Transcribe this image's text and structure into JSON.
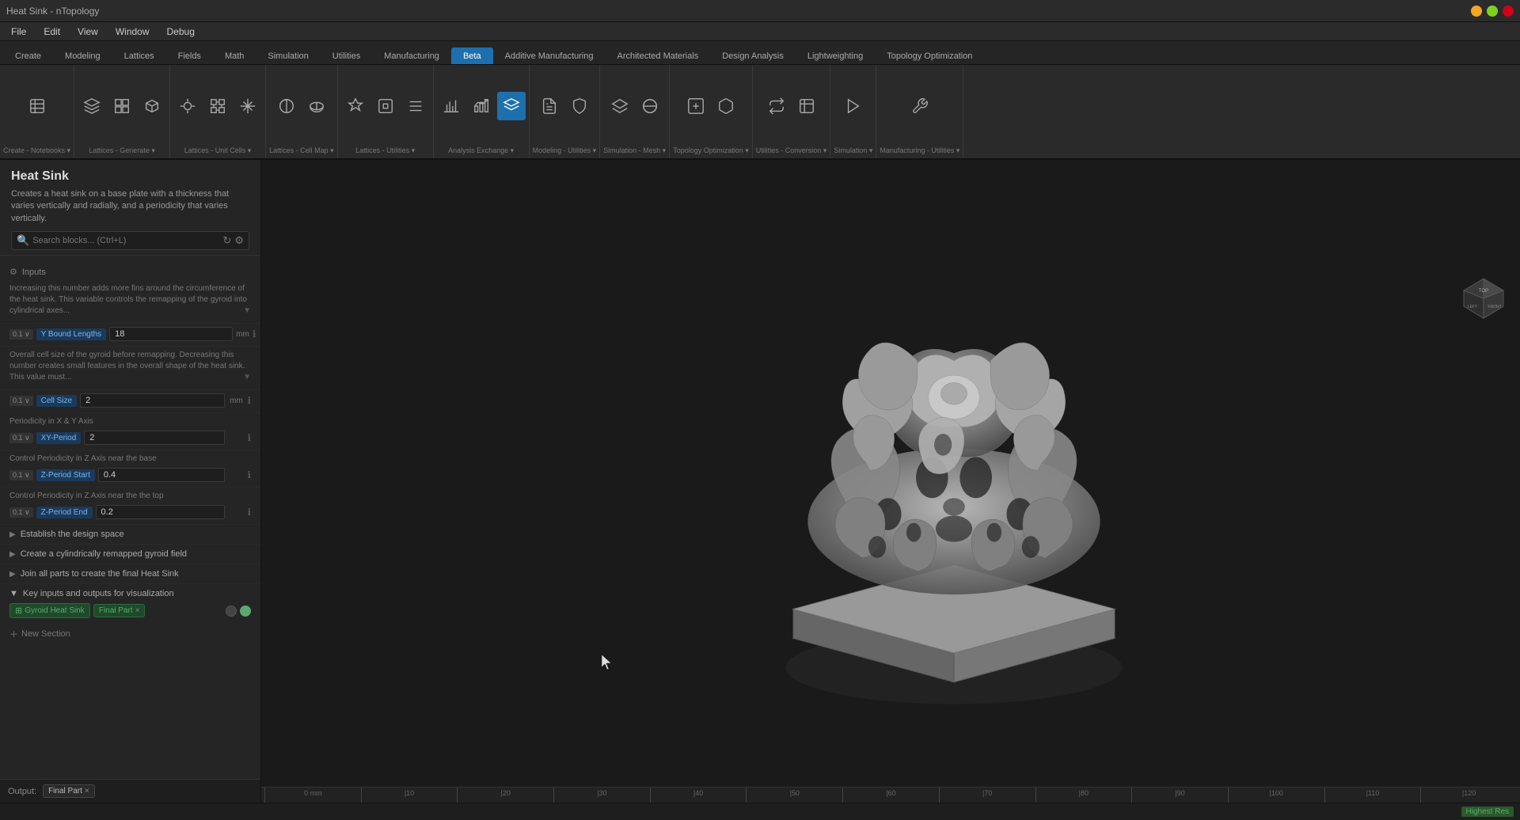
{
  "titlebar": {
    "title": "Heat Sink - nTopology"
  },
  "menubar": {
    "items": [
      "File",
      "Edit",
      "View",
      "Window",
      "Debug"
    ]
  },
  "toolbar_tabs": {
    "items": [
      {
        "label": "Create",
        "active": false
      },
      {
        "label": "Modeling",
        "active": false
      },
      {
        "label": "Lattices",
        "active": false
      },
      {
        "label": "Fields",
        "active": false
      },
      {
        "label": "Math",
        "active": false
      },
      {
        "label": "Simulation",
        "active": false
      },
      {
        "label": "Utilities",
        "active": false
      },
      {
        "label": "Manufacturing",
        "active": false
      },
      {
        "label": "Beta",
        "active": true
      },
      {
        "label": "Additive Manufacturing",
        "active": false
      },
      {
        "label": "Architected Materials",
        "active": false
      },
      {
        "label": "Design Analysis",
        "active": false
      },
      {
        "label": "Lightweighting",
        "active": false
      },
      {
        "label": "Topology Optimization",
        "active": false
      }
    ]
  },
  "toolbar_groups": [
    {
      "label": "Create - Notebooks",
      "icons": [
        "notebook-icon",
        "block-icon"
      ]
    },
    {
      "label": "Lattices - Generate",
      "icons": [
        "lattice-3d-icon",
        "lattice-wire-icon",
        "lattice-box-icon"
      ]
    },
    {
      "label": "Lattices - Unit Cells",
      "icons": [
        "unit-cell-icon",
        "unit-cell-2-icon",
        "unit-cell-3-icon"
      ]
    },
    {
      "label": "Lattices - Cell Map",
      "icons": [
        "cellmap-icon",
        "cellmap-2-icon"
      ]
    },
    {
      "label": "Lattices - Utilities",
      "icons": [
        "lattice-util-icon",
        "lattice-util-2-icon",
        "lattice-util-3-icon"
      ]
    },
    {
      "label": "Analysis Exchange",
      "icons": [
        "analysis-icon",
        "analysis-2-icon",
        "analysis-active-icon"
      ]
    },
    {
      "label": "Modeling - Utilities",
      "icons": [
        "modeling-util-icon",
        "modeling-util-2-icon"
      ]
    },
    {
      "label": "Simulation - Mesh",
      "icons": [
        "sim-mesh-icon",
        "sim-mesh-2-icon"
      ]
    },
    {
      "label": "Topology Optimization",
      "icons": [
        "topo-icon",
        "topo-2-icon"
      ]
    },
    {
      "label": "Utilities - Conversion",
      "icons": [
        "conversion-icon",
        "conversion-2-icon"
      ]
    },
    {
      "label": "Simulation",
      "icons": [
        "simulation-icon"
      ]
    },
    {
      "label": "Manufacturing - Utilities",
      "icons": [
        "mfg-util-icon"
      ]
    }
  ],
  "panel": {
    "title": "Heat Sink",
    "description": "Creates a heat sink on a base plate with a thickness that varies vertically and radially, and a periodicity that varies vertically.",
    "search_placeholder": "Search blocks... (Ctrl+L)",
    "inputs_label": "Inputs"
  },
  "parameters": [
    {
      "desc": "Increasing this number adds more fins around the circumference of the heat sink. This variable controls the remapping of the gyroid into cylindrical axes...",
      "has_expand": true
    },
    {
      "version": "0.1",
      "name": "Y Bound Lengths",
      "value": "18",
      "unit": "mm",
      "has_info": true
    },
    {
      "desc": "Overall cell size of the gyroid before remapping. Decreasing this number creates small features in the overall shape of the heat sink. This value must...",
      "has_expand": true
    },
    {
      "version": "0.1",
      "name": "Cell Size",
      "value": "2",
      "unit": "mm",
      "has_info": true
    },
    {
      "section": "Periodicity in X & Y Axis"
    },
    {
      "version": "0.1",
      "name": "XY-Period",
      "value": "2",
      "unit": "",
      "has_info": true
    },
    {
      "section": "Control Periodicity in Z Axis near the base"
    },
    {
      "version": "0.1",
      "name": "Z-Period Start",
      "value": "0.4",
      "unit": "",
      "has_info": true
    },
    {
      "section": "Control Periodicity in Z Axis near the the top"
    },
    {
      "version": "0.1",
      "name": "Z-Period End",
      "value": "0.2",
      "unit": "",
      "has_info": true
    }
  ],
  "sections": [
    {
      "label": "Establish the design space",
      "collapsed": true
    },
    {
      "label": "Create a cylindrically remapped gyroid field",
      "collapsed": true
    },
    {
      "label": "Join all parts to create the final Heat Sink",
      "collapsed": true
    },
    {
      "label": "Key inputs and outputs for visualization",
      "collapsed": false
    }
  ],
  "visualization": {
    "tags": [
      {
        "label": "Gyroid Heat Sink",
        "has_close": false,
        "active": true
      },
      {
        "label": "Final Part",
        "has_close": true
      }
    ]
  },
  "output": {
    "label": "Output:",
    "tag": "Final Part"
  },
  "ruler": {
    "marks": [
      "0 mm",
      "|10",
      "|20",
      "|30",
      "|40",
      "|50",
      "|60",
      "|70",
      "|80",
      "|90",
      "|100",
      "|110",
      "|120"
    ]
  },
  "statusbar": {
    "left": "",
    "resolution": "Highest Res"
  },
  "new_section": {
    "label": "New Section"
  }
}
